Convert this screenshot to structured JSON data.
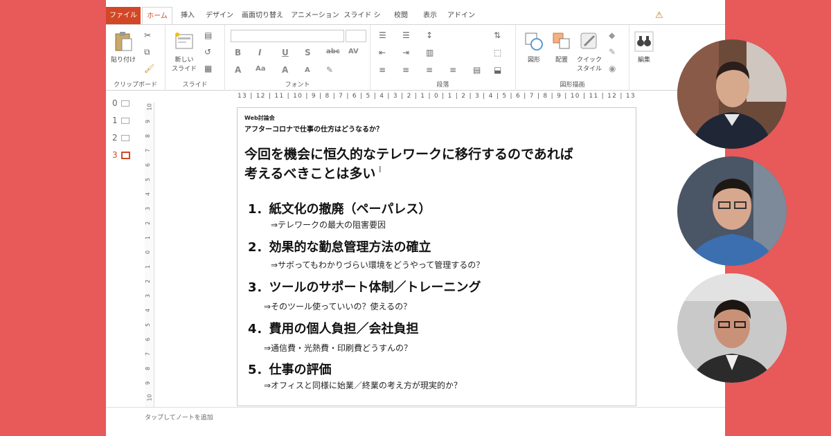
{
  "ribbon": {
    "tabs": [
      "ファイル",
      "ホーム",
      "挿入",
      "デザイン",
      "画面切り替え",
      "アニメーション",
      "スライド ショー",
      "校閲",
      "表示",
      "アドイン"
    ],
    "groups": {
      "clipboard": "クリップボード",
      "slides": "スライド",
      "font": "フォント",
      "paragraph": "段落",
      "drawing": "図形描画"
    },
    "buttons": {
      "paste": "貼り付け",
      "new_slide_line1": "新しい",
      "new_slide_line2": "スライド",
      "shapes": "図形",
      "arrange": "配置",
      "quick_style_line1": "クイック",
      "quick_style_line2": "スタイル",
      "edit": "編集"
    }
  },
  "ruler": "13 | 12 | 11 | 10 | 9 | 8 | 7 | 6 | 5 | 4 | 3 | 2 | 1 | 0 | 1 | 2 | 3 | 4 | 5 | 6 | 7 | 8 | 9 | 10 | 11 | 12 | 13",
  "vruler_ticks": [
    "10",
    "9",
    "8",
    "7",
    "6",
    "5",
    "4",
    "3",
    "2",
    "1",
    "0",
    "1",
    "2",
    "3",
    "4",
    "5",
    "6",
    "7",
    "8",
    "9",
    "10"
  ],
  "thumbnails": [
    "0",
    "1",
    "2",
    "3"
  ],
  "slide": {
    "tag": "Web討論会",
    "subtitle": "アフターコロナで仕事の仕方はどうなるか？",
    "title_line1": "今回を機会に恒久的なテレワークに移行するのであれば",
    "title_line2": "考えるべきことは多い",
    "items": [
      {
        "heading": "1．紙文化の撤廃（ペーパレス）",
        "note": "⇒テレワークの最大の阻害要因"
      },
      {
        "heading": "2．効果的な勤怠管理方法の確立",
        "note": "⇒サボってもわかりづらい環境をどうやって管理するの？"
      },
      {
        "heading": "3．ツールのサポート体制／トレーニング",
        "note": "⇒そのツール使っていいの？使えるの？"
      },
      {
        "heading": "4．費用の個人負担／会社負担",
        "note": "⇒通信費・光熱費・印刷費どうすんの？"
      },
      {
        "heading": "5．仕事の評価",
        "note": "⇒オフィスと同様に始業／終業の考え方が現実的か？"
      }
    ]
  },
  "notes_placeholder": "タップしてノートを追加",
  "colors": {
    "background": "#e8595a",
    "accent": "#d24726"
  }
}
